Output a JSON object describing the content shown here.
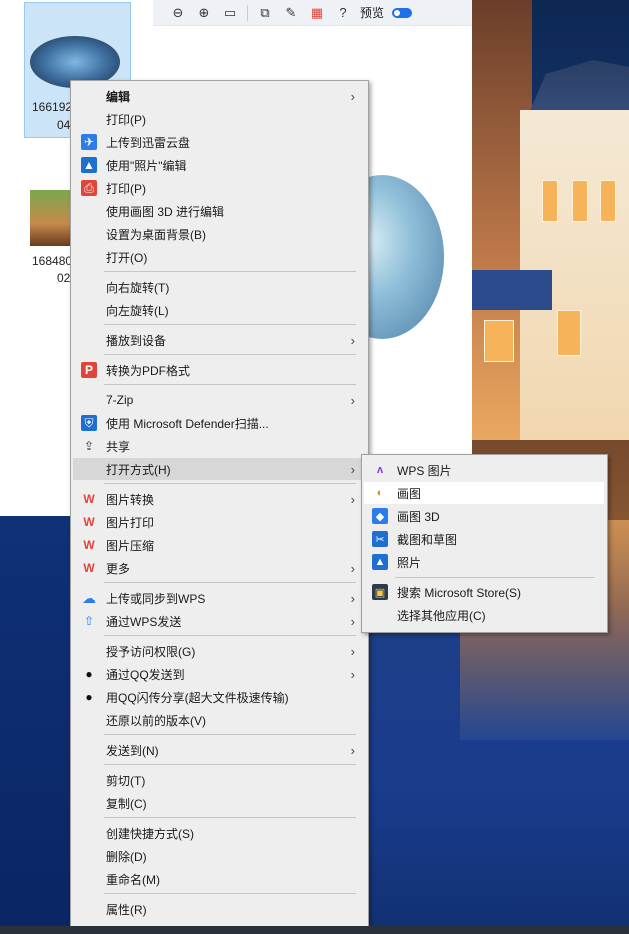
{
  "explorer": {
    "toolbar": {
      "zoom_out_icon": "zoom-out",
      "zoom_in_icon": "zoom-in",
      "print_icon": "print",
      "preview_label": "预览"
    },
    "files": [
      {
        "name_line1": "166192",
        "name_line2": "04"
      },
      {
        "name_line1": "168480",
        "name_line2": "02"
      }
    ]
  },
  "context_menu": {
    "items": [
      {
        "label": "编辑",
        "bold": true,
        "arrow": true
      },
      {
        "label": "打印(P)"
      },
      {
        "label": "上传到迅雷云盘",
        "icon": "xunlei-icon"
      },
      {
        "label": "使用\"照片\"编辑",
        "icon": "photos-icon"
      },
      {
        "label": "打印(P)",
        "icon": "printer-icon"
      },
      {
        "label": "使用画图 3D 进行编辑"
      },
      {
        "label": "设置为桌面背景(B)"
      },
      {
        "label": "打开(O)"
      },
      {
        "label": "向右旋转(T)"
      },
      {
        "label": "向左旋转(L)"
      },
      {
        "label": "播放到设备",
        "arrow": true
      },
      {
        "label": "转换为PDF格式",
        "icon": "pdf-icon"
      },
      {
        "label": "7-Zip",
        "arrow": true
      },
      {
        "label": "使用 Microsoft Defender扫描...",
        "icon": "defender-icon"
      },
      {
        "label": "共享",
        "icon": "share-icon"
      },
      {
        "label": "打开方式(H)",
        "arrow": true
      },
      {
        "label": "图片转换",
        "icon": "wps-icon",
        "arrow": true
      },
      {
        "label": "图片打印",
        "icon": "wps-icon"
      },
      {
        "label": "图片压缩",
        "icon": "wps-icon"
      },
      {
        "label": "更多",
        "icon": "wps-icon",
        "arrow": true
      },
      {
        "label": "上传或同步到WPS",
        "icon": "cloud-icon",
        "arrow": true
      },
      {
        "label": "通过WPS发送",
        "icon": "send-icon",
        "arrow": true
      },
      {
        "label": "授予访问权限(G)",
        "arrow": true
      },
      {
        "label": "通过QQ发送到",
        "icon": "qq-icon",
        "arrow": true
      },
      {
        "label": "用QQ闪传分享(超大文件极速传输)",
        "icon": "qq-icon"
      },
      {
        "label": "还原以前的版本(V)"
      },
      {
        "label": "发送到(N)",
        "arrow": true
      },
      {
        "label": "剪切(T)"
      },
      {
        "label": "复制(C)"
      },
      {
        "label": "创建快捷方式(S)"
      },
      {
        "label": "删除(D)"
      },
      {
        "label": "重命名(M)"
      },
      {
        "label": "属性(R)"
      }
    ]
  },
  "submenu": {
    "items": [
      {
        "label": "WPS 图片",
        "icon": "wps-pic-icon"
      },
      {
        "label": "画图",
        "icon": "paint-icon",
        "hover": true
      },
      {
        "label": "画图 3D",
        "icon": "paint3d-icon"
      },
      {
        "label": "截图和草图",
        "icon": "snip-icon"
      },
      {
        "label": "照片",
        "icon": "photos-icon"
      },
      {
        "label": "搜索 Microsoft Store(S)",
        "icon": "store-icon"
      },
      {
        "label": "选择其他应用(C)"
      }
    ]
  }
}
